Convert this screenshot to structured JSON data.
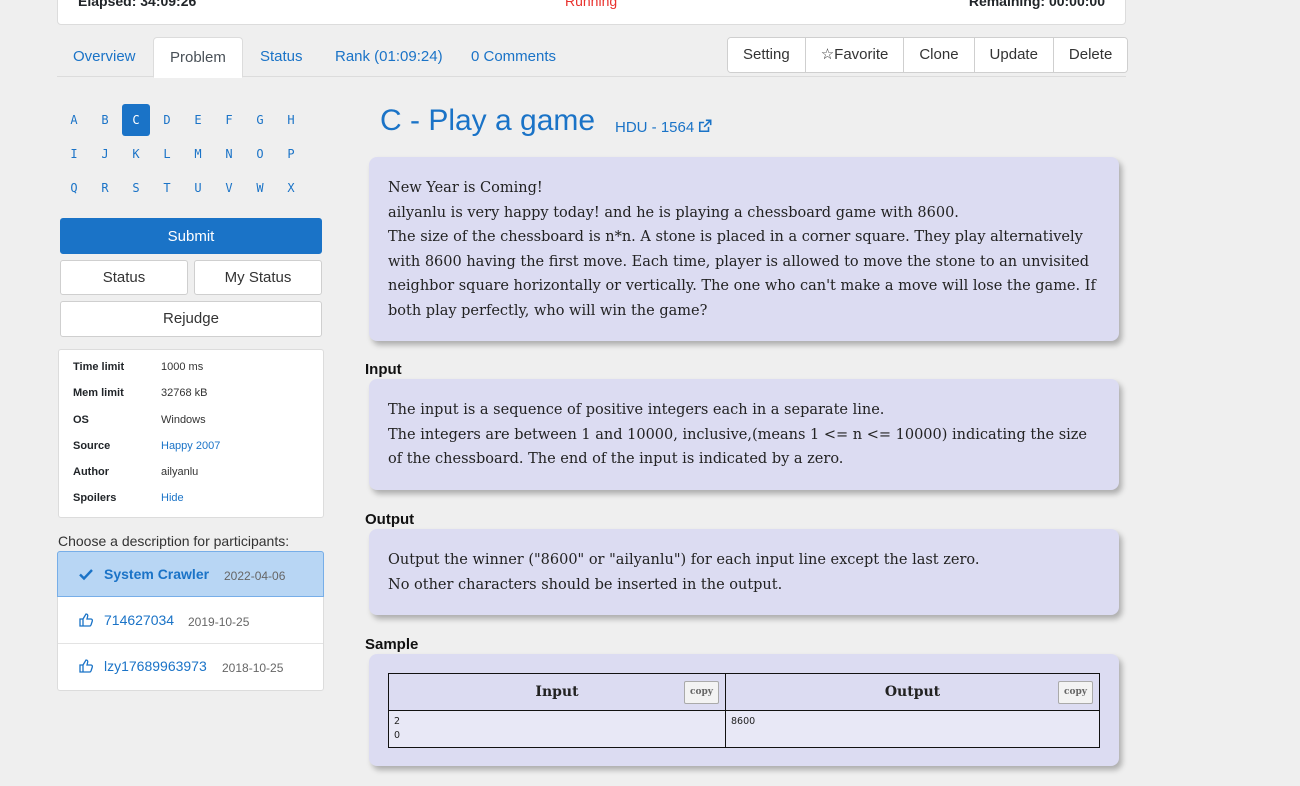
{
  "topbar": {
    "elapsed": "Elapsed: 34:09:26",
    "status": "Running",
    "remaining": "Remaining: 00:00:00"
  },
  "tabs": [
    "Overview",
    "Problem",
    "Status",
    "Rank (01:09:24)",
    "0 Comments"
  ],
  "actions": [
    "Setting",
    "☆Favorite",
    "Clone",
    "Update",
    "Delete"
  ],
  "letters": [
    "A",
    "B",
    "C",
    "D",
    "E",
    "F",
    "G",
    "H",
    "I",
    "J",
    "K",
    "L",
    "M",
    "N",
    "O",
    "P",
    "Q",
    "R",
    "S",
    "T",
    "U",
    "V",
    "W",
    "X"
  ],
  "active_letter": "C",
  "buttons": {
    "submit": "Submit",
    "status": "Status",
    "my_status": "My Status",
    "rejudge": "Rejudge"
  },
  "info": [
    {
      "k": "Time limit",
      "v": "1000 ms"
    },
    {
      "k": "Mem limit",
      "v": "32768 kB"
    },
    {
      "k": "OS",
      "v": "Windows"
    },
    {
      "k": "Source",
      "v": "Happy 2007"
    },
    {
      "k": "Author",
      "v": "ailyanlu"
    },
    {
      "k": "Spoilers",
      "v": "Hide"
    }
  ],
  "choose_label": "Choose a description for participants:",
  "descriptions": [
    {
      "name": "System Crawler",
      "date": "2022-04-06",
      "icon": "check-icon"
    },
    {
      "name": "714627034",
      "date": "2019-10-25",
      "icon": "thumbs-up-icon"
    },
    {
      "name": "lzy17689963973",
      "date": "2018-10-25",
      "icon": "thumbs-up-icon"
    }
  ],
  "problem": {
    "title": "C - Play a game",
    "origin": "HDU - 1564",
    "description": [
      "New Year is Coming!",
      "ailyanlu is very happy today! and he is playing a chessboard game with 8600.",
      "The size of the chessboard is n*n. A stone is placed in a corner square. They play alternatively with 8600 having the first move. Each time, player is allowed to move the stone to an unvisited neighbor square horizontally or vertically. The one who can't make a move will lose the game. If both play perfectly, who will win the game?"
    ],
    "input_label": "Input",
    "input": [
      "The input is a sequence of positive integers each in a separate line.",
      "The integers are between 1 and 10000, inclusive,(means 1 <= n <= 10000) indicating the size of the chessboard. The end of the input is indicated by a zero."
    ],
    "output_label": "Output",
    "output": [
      "Output the winner (\"8600\" or \"ailyanlu\") for each input line except the last zero.",
      "No other characters should be inserted in the output."
    ],
    "sample_label": "Sample",
    "sample": {
      "input_header": "Input",
      "output_header": "Output",
      "copy_label": "copy",
      "input_lines": [
        "2",
        "0"
      ],
      "output_lines": [
        "8600"
      ]
    }
  }
}
